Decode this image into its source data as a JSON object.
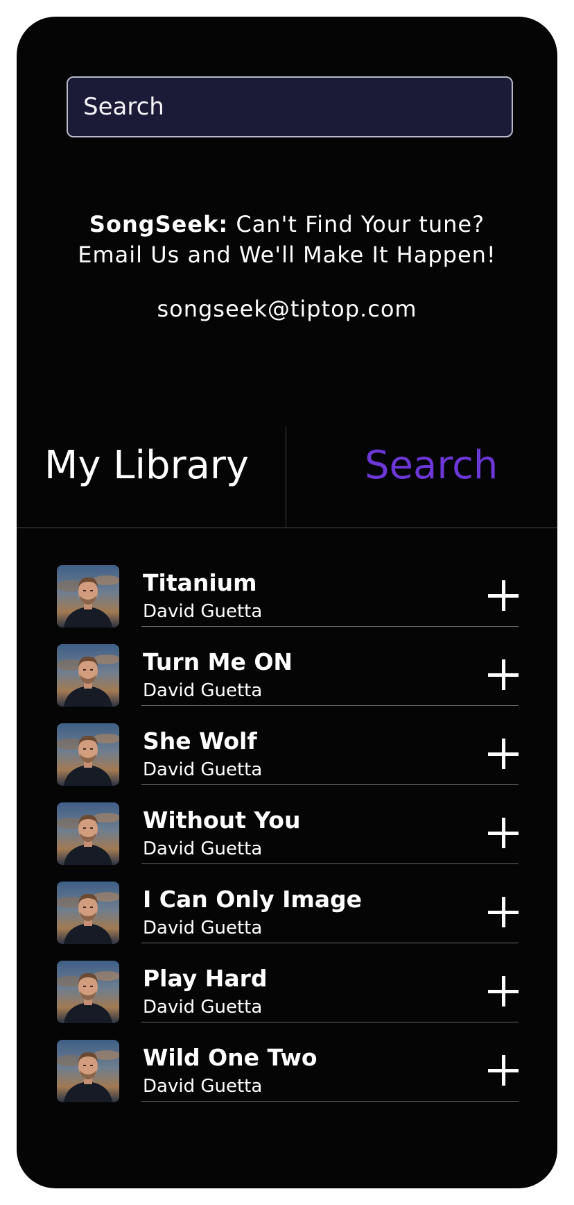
{
  "search": {
    "placeholder": "Search"
  },
  "promo": {
    "brand": "SongSeek:",
    "line1_rest": "Can't Find Your tune?",
    "line2": "Email Us and We'll Make It Happen!",
    "email": "songseek@tiptop.com"
  },
  "tabs": [
    {
      "label": "My Library",
      "active": false
    },
    {
      "label": "Search",
      "active": true
    }
  ],
  "colors": {
    "accent": "#6b37d6",
    "background": "#050505",
    "search_field": "#1b1b38"
  },
  "songs": [
    {
      "title": "Titanium",
      "artist": "David Guetta",
      "thumb": "artist-photo",
      "action_icon": "plus-icon"
    },
    {
      "title": "Turn Me ON",
      "artist": "David Guetta",
      "thumb": "artist-photo",
      "action_icon": "plus-icon"
    },
    {
      "title": "She Wolf",
      "artist": "David Guetta",
      "thumb": "artist-photo",
      "action_icon": "plus-icon"
    },
    {
      "title": "Without You",
      "artist": "David Guetta",
      "thumb": "artist-photo",
      "action_icon": "plus-icon"
    },
    {
      "title": "I Can Only Image",
      "artist": "David Guetta",
      "thumb": "artist-photo",
      "action_icon": "plus-icon"
    },
    {
      "title": "Play Hard",
      "artist": "David Guetta",
      "thumb": "artist-photo",
      "action_icon": "plus-icon"
    },
    {
      "title": "Wild One Two",
      "artist": "David Guetta",
      "thumb": "artist-photo",
      "action_icon": "plus-icon"
    }
  ]
}
